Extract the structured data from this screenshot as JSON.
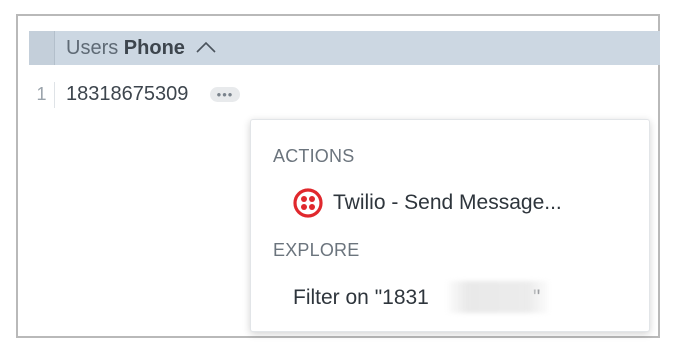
{
  "table": {
    "header": {
      "view_name": "Users",
      "field_name": "Phone",
      "sort_icon": "chevron-up-icon"
    },
    "rows": [
      {
        "row_number": "1",
        "phone": "18318675309"
      }
    ],
    "more_button_label": "•••"
  },
  "popup": {
    "actions_label": "ACTIONS",
    "actions": [
      {
        "label": "Twilio - Send Message...",
        "icon": "twilio-icon",
        "icon_color": "#e0282d"
      }
    ],
    "explore_label": "EXPLORE",
    "explore": [
      {
        "label_prefix": "Filter on \"1831",
        "label_suffix": "\""
      }
    ]
  }
}
